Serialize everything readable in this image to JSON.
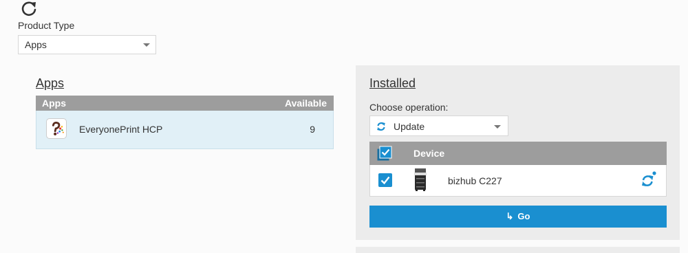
{
  "product_type": {
    "label": "Product Type",
    "selected": "Apps"
  },
  "apps": {
    "title": "Apps",
    "headers": {
      "apps": "Apps",
      "available": "Available"
    },
    "rows": [
      {
        "name": "EveryonePrint HCP",
        "available": "9",
        "icon": "everyoneprint-logo-icon"
      }
    ]
  },
  "installed": {
    "title": "Installed",
    "operation_label": "Choose operation:",
    "operation_selected": "Update",
    "operation_icon": "sync-icon",
    "device_header": "Device",
    "devices": [
      {
        "name": "bizhub C227",
        "checked": true,
        "icon": "printer-icon",
        "status_icon": "sync-icon"
      }
    ],
    "go_label": "Go",
    "go_icon": "enter-arrow-icon"
  },
  "colors": {
    "accent": "#1a8fd0",
    "header_gray": "#9d9d9d",
    "selected_row": "#e1f0f7",
    "panel_bg": "#ececec"
  }
}
